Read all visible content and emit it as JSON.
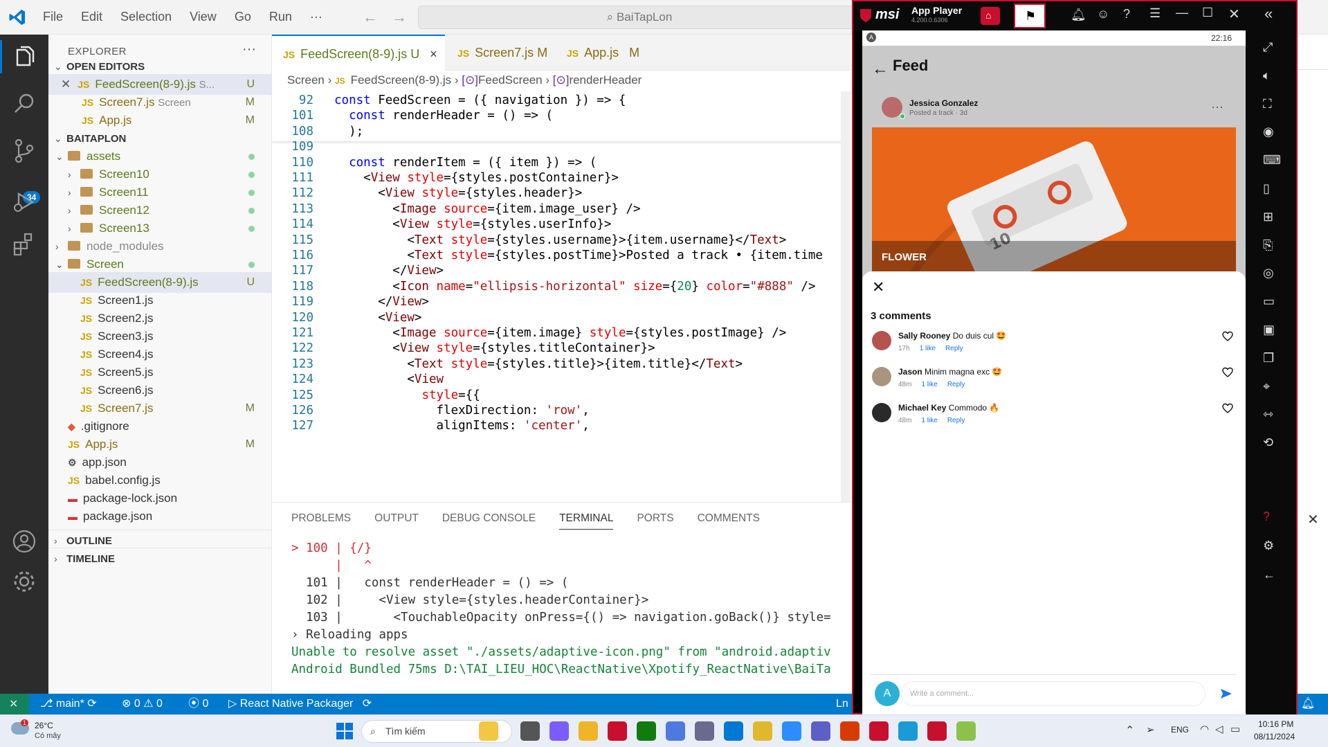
{
  "titlebar": {
    "menu": [
      "File",
      "Edit",
      "Selection",
      "View",
      "Go",
      "Run",
      "···"
    ],
    "search": "BaiTapLon"
  },
  "activity": {
    "scm_badge": "34"
  },
  "sidebar": {
    "title": "EXPLORER",
    "more": "···",
    "open_editors_label": "OPEN EDITORS",
    "open_editors": [
      {
        "name": "FeedScreen(8-9).js",
        "extra": "S...",
        "status": "U"
      },
      {
        "name": "Screen7.js",
        "extra": "Screen",
        "status": "M"
      },
      {
        "name": "App.js",
        "extra": "",
        "status": "M"
      }
    ],
    "project_label": "BAITAPLON",
    "tree": [
      {
        "name": "assets",
        "kind": "folder-open",
        "indent": 1,
        "status": "dot"
      },
      {
        "name": "Screen10",
        "kind": "folder",
        "indent": 2,
        "status": "dot"
      },
      {
        "name": "Screen11",
        "kind": "folder",
        "indent": 2,
        "status": "dot"
      },
      {
        "name": "Screen12",
        "kind": "folder",
        "indent": 2,
        "status": "dot"
      },
      {
        "name": "Screen13",
        "kind": "folder",
        "indent": 2,
        "status": "dot"
      },
      {
        "name": "node_modules",
        "kind": "folder",
        "indent": 1,
        "status": ""
      },
      {
        "name": "Screen",
        "kind": "folder-open",
        "indent": 1,
        "status": "dot"
      },
      {
        "name": "FeedScreen(8-9).js",
        "kind": "js",
        "indent": 2,
        "status": "U"
      },
      {
        "name": "Screen1.js",
        "kind": "js",
        "indent": 2,
        "status": ""
      },
      {
        "name": "Screen2.js",
        "kind": "js",
        "indent": 2,
        "status": ""
      },
      {
        "name": "Screen3.js",
        "kind": "js",
        "indent": 2,
        "status": ""
      },
      {
        "name": "Screen4.js",
        "kind": "js",
        "indent": 2,
        "status": ""
      },
      {
        "name": "Screen5.js",
        "kind": "js",
        "indent": 2,
        "status": ""
      },
      {
        "name": "Screen6.js",
        "kind": "js",
        "indent": 2,
        "status": ""
      },
      {
        "name": "Screen7.js",
        "kind": "js",
        "indent": 2,
        "status": "M"
      },
      {
        "name": ".gitignore",
        "kind": "git",
        "indent": 1,
        "status": ""
      },
      {
        "name": "App.js",
        "kind": "js",
        "indent": 1,
        "status": "M"
      },
      {
        "name": "app.json",
        "kind": "json",
        "indent": 1,
        "status": ""
      },
      {
        "name": "babel.config.js",
        "kind": "js",
        "indent": 1,
        "status": ""
      },
      {
        "name": "package-lock.json",
        "kind": "npm",
        "indent": 1,
        "status": ""
      },
      {
        "name": "package.json",
        "kind": "npm",
        "indent": 1,
        "status": ""
      }
    ],
    "outline_label": "OUTLINE",
    "timeline_label": "TIMELINE"
  },
  "editor": {
    "tabs": [
      {
        "name": "FeedScreen(8-9).js",
        "status": "U",
        "close": "×"
      },
      {
        "name": "Screen7.js",
        "status": "M"
      },
      {
        "name": "App.js",
        "status": "M"
      }
    ],
    "breadcrumb": [
      "Screen",
      "FeedScreen(8-9).js",
      "FeedScreen",
      "renderHeader"
    ],
    "lines": [
      {
        "n": "92",
        "t": "const FeedScreen = ({ navigation }) => {"
      },
      {
        "n": "101",
        "t": "  const renderHeader = () => ("
      },
      {
        "n": "108",
        "t": "  );"
      },
      {
        "n": "109",
        "t": ""
      },
      {
        "n": "110",
        "t": "  const renderItem = ({ item }) => ("
      },
      {
        "n": "111",
        "t": "    <View style={styles.postContainer}>"
      },
      {
        "n": "112",
        "t": "      <View style={styles.header}>"
      },
      {
        "n": "113",
        "t": "        <Image source={item.image_user} />"
      },
      {
        "n": "114",
        "t": "        <View style={styles.userInfo}>"
      },
      {
        "n": "115",
        "t": "          <Text style={styles.username}>{item.username}</Text>"
      },
      {
        "n": "116",
        "t": "          <Text style={styles.postTime}>Posted a track • {item.time"
      },
      {
        "n": "117",
        "t": "        </View>"
      },
      {
        "n": "118",
        "t": "        <Icon name=\"ellipsis-horizontal\" size={20} color=\"#888\" />"
      },
      {
        "n": "119",
        "t": "      </View>"
      },
      {
        "n": "120",
        "t": "      <View>"
      },
      {
        "n": "121",
        "t": "        <Image source={item.image} style={styles.postImage} />"
      },
      {
        "n": "122",
        "t": "        <View style={styles.titleContainer}>"
      },
      {
        "n": "123",
        "t": "          <Text style={styles.title}>{item.title}</Text>"
      },
      {
        "n": "124",
        "t": "          <View"
      },
      {
        "n": "125",
        "t": "            style={{"
      },
      {
        "n": "126",
        "t": "              flexDirection: 'row',"
      },
      {
        "n": "127",
        "t": "              alignItems: 'center',"
      }
    ]
  },
  "panel": {
    "tabs": [
      "PROBLEMS",
      "OUTPUT",
      "DEBUG CONSOLE",
      "TERMINAL",
      "PORTS",
      "COMMENTS"
    ],
    "active_tab": "TERMINAL",
    "terminal": [
      "> 100 | {/}",
      "      |   ^",
      "  101 |   const renderHeader = () => (",
      "  102 |     <View style={styles.headerContainer}>",
      "  103 |       <TouchableOpacity onPress={() => navigation.goBack()} style=",
      "› Reloading apps",
      "Unable to resolve asset \"./assets/adaptive-icon.png\" from \"android.adaptiv",
      "Android Bundled 75ms D:\\TAI_LIEU_HOC\\ReactNative\\Xpotify_ReactNative\\BaiTa"
    ]
  },
  "statusbar": {
    "branch": "main*",
    "errors": "0",
    "warnings": "0",
    "ports": "0",
    "packager": "React Native Packager",
    "ln": "Ln"
  },
  "emulator": {
    "brand": "msi",
    "app_name": "App Player",
    "version": "4.200.0.6306",
    "status_time": "22:16",
    "feed_title": "Feed",
    "post": {
      "username": "Jessica Gonzalez",
      "subtitle": "Posted a track · 3d",
      "more": "···",
      "title": "FLOWER"
    },
    "comments_count": "3 comments",
    "close": "✕",
    "comments": [
      {
        "name": "Sally Rooney",
        "text": "Do duis cul 🤩",
        "time": "17h",
        "likes": "1 like",
        "reply": "Reply"
      },
      {
        "name": "Jason",
        "text": "Minim magna exc 🤩",
        "time": "48m",
        "likes": "1 like",
        "reply": "Reply"
      },
      {
        "name": "Michael Key",
        "text": "Commodo 🔥",
        "time": "48m",
        "likes": "1 like",
        "reply": "Reply"
      }
    ],
    "input_avatar": "A",
    "input_placeholder": "Write a comment..."
  },
  "taskbar": {
    "weather_temp": "26°C",
    "weather_desc": "Có mây",
    "weather_badge": "1",
    "search": "Tìm kiếm",
    "lang": "ENG",
    "time": "10:16 PM",
    "date": "08/11/2024"
  },
  "colors": {
    "accent": "#0078d4",
    "statusbar": "#007acc",
    "emulator_border": "#c8102e",
    "cassette_bg": "#e9651a",
    "link_blue": "#1a73e8",
    "send_blue": "#1a73e8"
  }
}
